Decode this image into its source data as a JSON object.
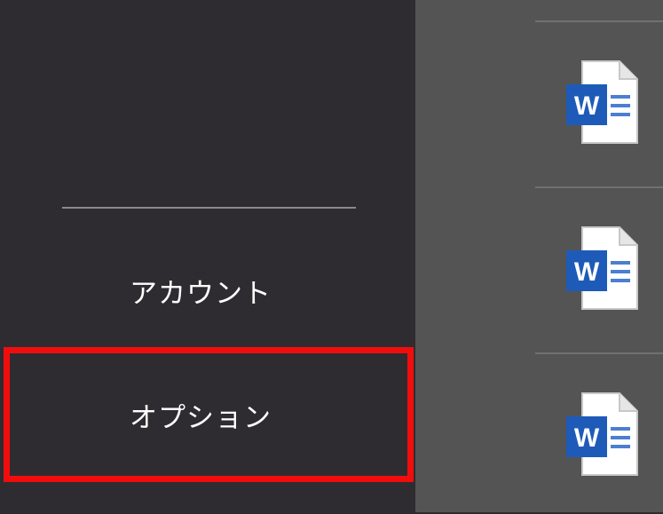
{
  "sidebar": {
    "items": [
      {
        "label": "アカウント"
      },
      {
        "label": "オプション"
      }
    ]
  },
  "files": [
    {
      "icon": "word-document-icon"
    },
    {
      "icon": "word-document-icon"
    },
    {
      "icon": "word-document-icon"
    }
  ],
  "colors": {
    "sidebar_bg": "#2e2c30",
    "content_bg": "#545454",
    "highlight": "#f20d0d",
    "word_blue": "#1e5bb8"
  }
}
